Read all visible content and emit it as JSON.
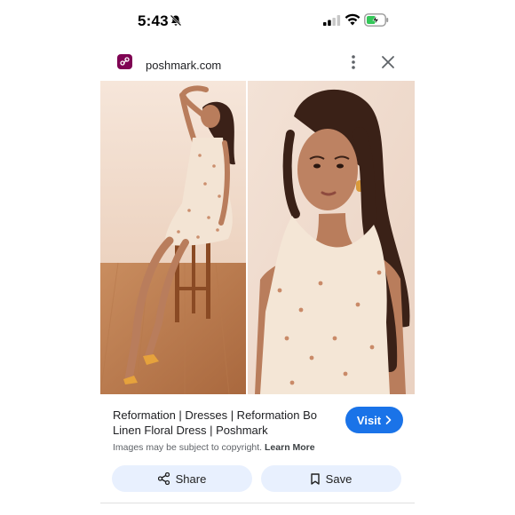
{
  "status_bar": {
    "time": "5:43",
    "icons": [
      "bell-slash-icon",
      "cellular-signal-icon",
      "wifi-icon",
      "battery-charging-icon"
    ]
  },
  "header": {
    "site_name": "poshmark.com",
    "favicon": "poshmark-logo-icon",
    "menu_icon": "more-vert-icon",
    "close_icon": "close-icon"
  },
  "result": {
    "title": "Reformation | Dresses | Reformation Bo Linen Floral Dress | Poshmark",
    "visit_label": "Visit",
    "copyright_text": "Images may be subject to copyright.",
    "learn_more_label": "Learn More"
  },
  "actions": {
    "share_label": "Share",
    "save_label": "Save"
  },
  "colors": {
    "accent": "#1a73e8",
    "action_bg": "#e8f0fe",
    "favicon_bg": "#7f0353"
  }
}
